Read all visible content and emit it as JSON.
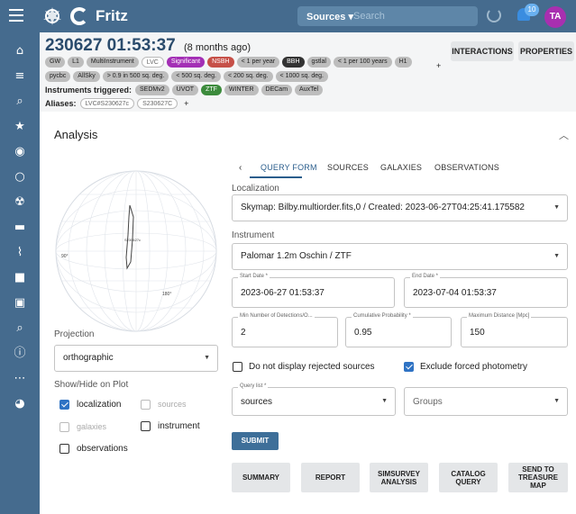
{
  "app": {
    "name": "Fritz",
    "user_initials": "TA",
    "notification_count": "10"
  },
  "search": {
    "scope": "Sources",
    "placeholder": "Search"
  },
  "source": {
    "title": "230627 01:53:37",
    "age": "(8 months ago)",
    "buttons": {
      "interactions": "INTERACTIONS",
      "properties": "PROPERTIES"
    },
    "tags_row1": [
      {
        "text": "GW",
        "style": "grey"
      },
      {
        "text": "L1",
        "style": "grey"
      },
      {
        "text": "MultiInstrument",
        "style": "grey"
      },
      {
        "text": "LVC",
        "style": "outlined"
      },
      {
        "text": "Significant",
        "style": "purple"
      },
      {
        "text": "NSBH",
        "style": "red"
      },
      {
        "text": "< 1 per year",
        "style": "grey"
      },
      {
        "text": "BBH",
        "style": "black"
      },
      {
        "text": "gstlal",
        "style": "grey"
      },
      {
        "text": "< 1 per 100 years",
        "style": "grey"
      },
      {
        "text": "H1",
        "style": "grey"
      }
    ],
    "tags_row2": [
      {
        "text": "pycbc",
        "style": "grey"
      },
      {
        "text": "AllSky",
        "style": "grey"
      },
      {
        "text": "> 0.9 in 500 sq. deg.",
        "style": "grey"
      },
      {
        "text": "< 500 sq. deg.",
        "style": "grey"
      },
      {
        "text": "< 200 sq. deg.",
        "style": "grey"
      },
      {
        "text": "< 1000 sq. deg.",
        "style": "grey"
      }
    ],
    "instruments_label": "Instruments triggered:",
    "instruments": [
      {
        "text": "SEDMv2",
        "style": "grey"
      },
      {
        "text": "UVOT",
        "style": "grey"
      },
      {
        "text": "ZTF",
        "style": "green"
      },
      {
        "text": "WINTER",
        "style": "grey"
      },
      {
        "text": "DECam",
        "style": "grey"
      },
      {
        "text": "AuxTel",
        "style": "grey"
      }
    ],
    "aliases_label": "Aliases:",
    "aliases": [
      "LVC#S230627c",
      "S230627C"
    ],
    "plus": "+"
  },
  "analysis": {
    "title": "Analysis",
    "tabs": [
      "QUERY FORM",
      "SOURCES",
      "GALAXIES",
      "OBSERVATIONS"
    ],
    "active_tab": "QUERY FORM",
    "globe_labels": {
      "top": "S230627c",
      "left": "90°",
      "right": "180°"
    },
    "projection_label": "Projection",
    "projection_value": "orthographic",
    "show_hide_label": "Show/Hide on Plot",
    "show_hide": {
      "localization": {
        "label": "localization",
        "checked": true,
        "disabled": false
      },
      "sources": {
        "label": "sources",
        "checked": false,
        "disabled": true
      },
      "galaxies": {
        "label": "galaxies",
        "checked": false,
        "disabled": true
      },
      "instrument": {
        "label": "instrument",
        "checked": false,
        "disabled": false
      },
      "observations": {
        "label": "observations",
        "checked": false,
        "disabled": false
      }
    },
    "localization_label": "Localization",
    "localization_value": "Skymap: Bilby.multiorder.fits,0 / Created: 2023-06-27T04:25:41.175582",
    "instrument_label": "Instrument",
    "instrument_value": "Palomar 1.2m Oschin / ZTF",
    "start_date": {
      "label": "Start Date *",
      "value": "2023-06-27 01:53:37"
    },
    "end_date": {
      "label": "End Date *",
      "value": "2023-07-04 01:53:37"
    },
    "min_detections": {
      "label": "Min Number of Detections/O...",
      "value": "2"
    },
    "cumulative_probability": {
      "label": "Cumulative Probability *",
      "value": "0.95"
    },
    "max_distance": {
      "label": "Maximum Distance [Mpc]",
      "value": "150"
    },
    "do_not_display_rejected": {
      "label": "Do not display rejected sources",
      "checked": false
    },
    "exclude_forced": {
      "label": "Exclude forced photometry",
      "checked": true
    },
    "query_list": {
      "label": "Query list *",
      "value": "sources"
    },
    "groups": {
      "placeholder": "Groups"
    },
    "submit": "SUBMIT",
    "actions": {
      "summary": "SUMMARY",
      "report": "REPORT",
      "simsurvey": "SIMSURVEY ANALYSIS",
      "catalog_query": "CATALOG QUERY",
      "treasure_map": "SEND TO TREASURE MAP"
    }
  },
  "colors": {
    "header_bg": "#456b8e",
    "accent": "#2a5d8c",
    "purple": "#a32fb5",
    "red": "#c65048",
    "green": "#3c8b3c"
  }
}
